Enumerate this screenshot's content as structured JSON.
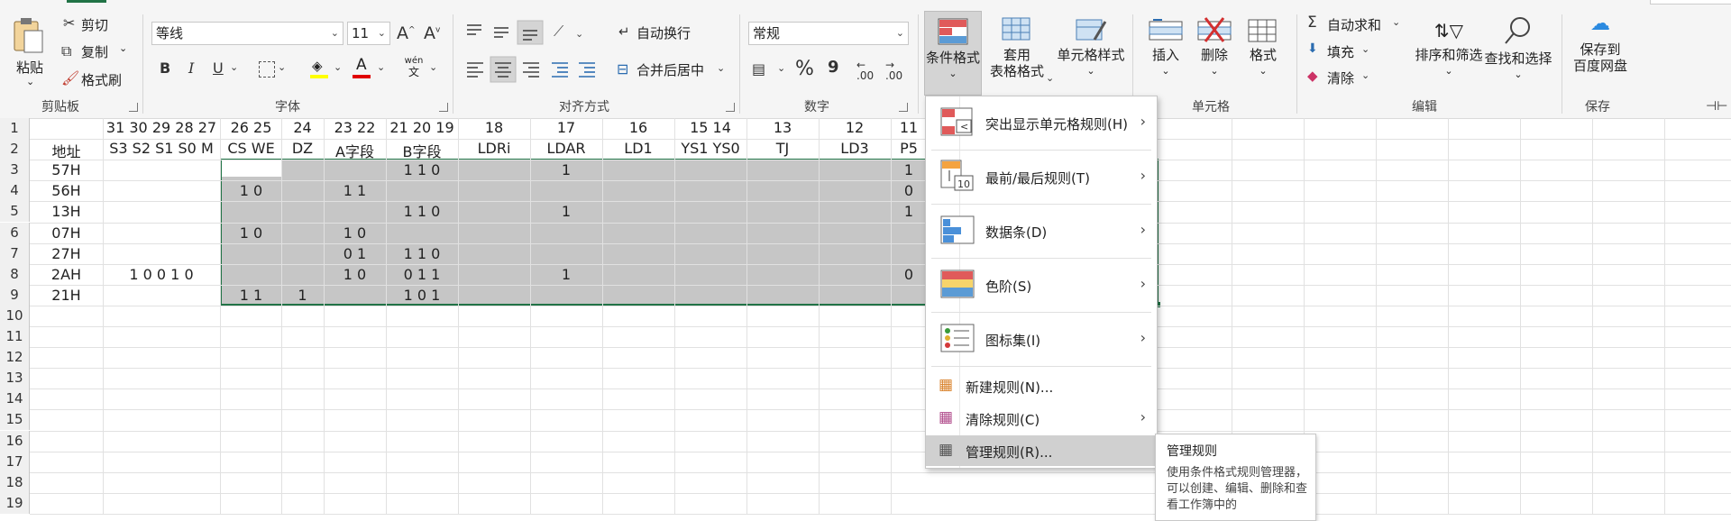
{
  "ribbon": {
    "clipboard": {
      "paste": "粘贴",
      "cut": "剪切",
      "copy": "复制",
      "format_painter": "格式刷",
      "group": "剪贴板"
    },
    "font": {
      "name": "等线",
      "size": "11",
      "group": "字体",
      "bold": "B",
      "italic": "I",
      "underline": "U",
      "grow": "A",
      "shrink": "A",
      "wen": "wén",
      "wen_sub": "文"
    },
    "alignment": {
      "wrap": "自动换行",
      "merge": "合并后居中",
      "group": "对齐方式"
    },
    "number": {
      "format": "常规",
      "percent": "%",
      "comma": "9",
      "inc_dec": ".00",
      "dec_dec": ".00",
      "group": "数字"
    },
    "styles": {
      "cond_format": "条件格式",
      "table_line1": "套用",
      "table_line2": "表格格式",
      "cell_styles": "单元格样式"
    },
    "cells": {
      "insert": "插入",
      "delete": "删除",
      "format": "格式",
      "group": "单元格"
    },
    "editing": {
      "autosum": "自动求和",
      "fill": "填充",
      "clear": "清除",
      "sort_filter": "排序和筛选",
      "find_select": "查找和选择",
      "group": "编辑"
    },
    "save": {
      "line1": "保存到",
      "line2": "百度网盘",
      "group": "保存"
    }
  },
  "grid": {
    "rows": [
      "1",
      "2",
      "3",
      "4",
      "5",
      "6",
      "7",
      "8",
      "9",
      "10",
      "11",
      "12",
      "13",
      "14",
      "15",
      "16",
      "17",
      "18",
      "19"
    ],
    "row1": [
      "31 30 29 28 27",
      "26 25",
      "24",
      "23 22",
      "21 20 19",
      "18",
      "17",
      "16",
      "15 14",
      "13",
      "12",
      "11"
    ],
    "row2": [
      "地址",
      "S3 S2 S1 S0 M",
      "CS WE",
      "DZ",
      "A字段",
      "B字段",
      "LDRi",
      "LDAR",
      "LD1",
      "YS1 YS0",
      "TJ",
      "LD3",
      "P5"
    ],
    "col_a": [
      "57H",
      "56H",
      "13H",
      "07H",
      "27H",
      "2AH",
      "21H"
    ],
    "cells": [
      {
        "r": 3,
        "c": "F",
        "v": "1 1 0"
      },
      {
        "r": 3,
        "c": "H",
        "v": "1"
      },
      {
        "r": 3,
        "c": "M",
        "v": "1"
      },
      {
        "r": 4,
        "c": "D",
        "v": "1 0"
      },
      {
        "r": 4,
        "c": "E2",
        "v": "1 1"
      },
      {
        "r": 4,
        "c": "M",
        "v": "0"
      },
      {
        "r": 5,
        "c": "F",
        "v": "1 1 0"
      },
      {
        "r": 5,
        "c": "H",
        "v": "1"
      },
      {
        "r": 5,
        "c": "M",
        "v": "1"
      },
      {
        "r": 6,
        "c": "D",
        "v": "1 0"
      },
      {
        "r": 6,
        "c": "E2",
        "v": "1 0"
      },
      {
        "r": 7,
        "c": "E2",
        "v": "0 1"
      },
      {
        "r": 7,
        "c": "F",
        "v": "1 1 0"
      },
      {
        "r": 8,
        "c": "B",
        "v": "1 0 0 1 0"
      },
      {
        "r": 8,
        "c": "E2",
        "v": "1 0"
      },
      {
        "r": 8,
        "c": "F",
        "v": "0 1 1"
      },
      {
        "r": 8,
        "c": "H",
        "v": "1"
      },
      {
        "r": 8,
        "c": "M",
        "v": "0"
      },
      {
        "r": 9,
        "c": "D",
        "v": "1 1"
      },
      {
        "r": 9,
        "c": "E",
        "v": "1"
      },
      {
        "r": 9,
        "c": "F",
        "v": "1 0 1"
      }
    ]
  },
  "menu": {
    "items": [
      {
        "label": "突出显示单元格规则(H)",
        "icon": "highlight-rules-icon"
      },
      {
        "label": "最前/最后规则(T)",
        "icon": "top-bottom-rules-icon"
      },
      {
        "label": "数据条(D)",
        "icon": "data-bars-icon"
      },
      {
        "label": "色阶(S)",
        "icon": "color-scales-icon"
      },
      {
        "label": "图标集(I)",
        "icon": "icon-sets-icon"
      }
    ],
    "small_items": [
      {
        "label": "新建规则(N)...",
        "icon": "new-rule-icon"
      },
      {
        "label": "清除规则(C)",
        "icon": "clear-rules-icon"
      },
      {
        "label": "管理规则(R)...",
        "icon": "manage-rules-icon"
      }
    ],
    "top_icon_label": "10"
  },
  "tooltip": {
    "title": "管理规则",
    "body": "使用条件格式规则管理器，可以创建、编辑、删除和查看工作簿中的"
  },
  "colors": {
    "accent": "#217346",
    "selection_border": "#217346",
    "gray_fill": "#c6c6c6",
    "menu_hover": "#d0d0d0"
  }
}
